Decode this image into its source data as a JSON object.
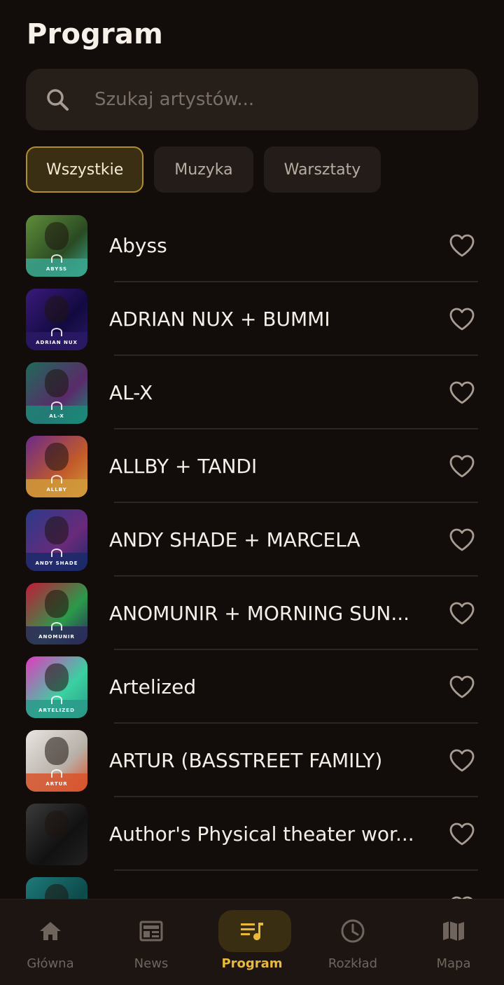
{
  "header": {
    "title": "Program"
  },
  "search": {
    "placeholder": "Szukaj artystów..."
  },
  "filters": [
    {
      "label": "Wszystkie",
      "active": true
    },
    {
      "label": "Muzyka",
      "active": false
    },
    {
      "label": "Warsztaty",
      "active": false
    }
  ],
  "artists": [
    {
      "name": "Abyss",
      "thumb_label": "ABYSS",
      "colors": [
        "#5f8d3a",
        "#2a4a22",
        "#3aa58f"
      ]
    },
    {
      "name": "ADRIAN NUX + BUMMI",
      "thumb_label": "ADRIAN NUX",
      "colors": [
        "#3a1a7a",
        "#120a40",
        "#2a1a66"
      ]
    },
    {
      "name": "AL-X",
      "thumb_label": "AL-X",
      "colors": [
        "#1f6a5a",
        "#5a2a6a",
        "#1a8a78"
      ]
    },
    {
      "name": "ALLBY + TANDI",
      "thumb_label": "ALLBY",
      "colors": [
        "#6a2a8a",
        "#c25a2a",
        "#d19a3a"
      ]
    },
    {
      "name": "ANDY SHADE + MARCELA",
      "thumb_label": "ANDY SHADE",
      "colors": [
        "#2a3a8a",
        "#6a2a7a",
        "#1a2a6a"
      ]
    },
    {
      "name": "ANOMUNIR + MORNING SUN...",
      "thumb_label": "ANOMUNIR",
      "colors": [
        "#c21a3a",
        "#2a9a4a",
        "#2a2a5a"
      ]
    },
    {
      "name": "Artelized",
      "thumb_label": "ARTELIZED",
      "colors": [
        "#e23ac0",
        "#3ad0a0",
        "#2a9a8a"
      ]
    },
    {
      "name": "ARTUR (BASSTREET FAMILY)",
      "thumb_label": "ARTUR",
      "colors": [
        "#e8e4e0",
        "#b8b0a8",
        "#d8542a"
      ]
    },
    {
      "name": "Author's Physical theater wor...",
      "thumb_label": "",
      "colors": [
        "#3a3a3a",
        "#111111",
        "#222222"
      ]
    },
    {
      "name": "",
      "thumb_label": "",
      "colors": [
        "#1e7a7a",
        "#0e4a4a",
        "#1a5a5a"
      ]
    }
  ],
  "nav": [
    {
      "label": "Główna",
      "icon": "home-icon",
      "active": false
    },
    {
      "label": "News",
      "icon": "newspaper-icon",
      "active": false
    },
    {
      "label": "Program",
      "icon": "playlist-music-icon",
      "active": true
    },
    {
      "label": "Rozkład",
      "icon": "clock-icon",
      "active": false
    },
    {
      "label": "Mapa",
      "icon": "map-icon",
      "active": false
    }
  ],
  "colors": {
    "background": "#120d0b",
    "accent": "#e8b93b",
    "chip_active_border": "#b08e2c"
  }
}
